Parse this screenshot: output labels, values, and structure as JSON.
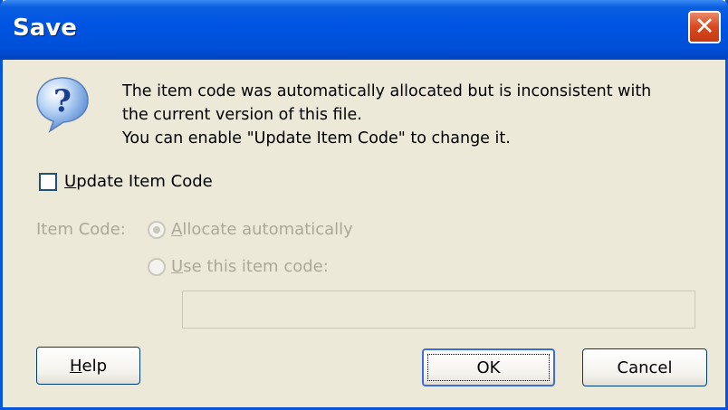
{
  "window": {
    "title": "Save"
  },
  "message": {
    "lines": [
      "The item code was automatically allocated but is inconsistent with",
      "the current version of this file.",
      "You can enable \"Update Item Code\" to change it."
    ]
  },
  "update_checkbox": {
    "label_accel": "U",
    "label_rest": "pdate Item Code",
    "checked": false
  },
  "item_code": {
    "label": "Item Code:",
    "options": [
      {
        "accel": "A",
        "rest": "llocate automatically",
        "selected": true
      },
      {
        "accel": "U",
        "rest": "se this item code:",
        "selected": false
      }
    ],
    "field_value": ""
  },
  "buttons": {
    "help_accel": "H",
    "help_rest": "elp",
    "ok": "OK",
    "cancel": "Cancel"
  },
  "colors": {
    "titlebar": "#0054e3",
    "face": "#ece9d8",
    "disabled_text": "#aca899"
  },
  "icons": {
    "dialog": "question-icon",
    "close": "close-icon"
  }
}
